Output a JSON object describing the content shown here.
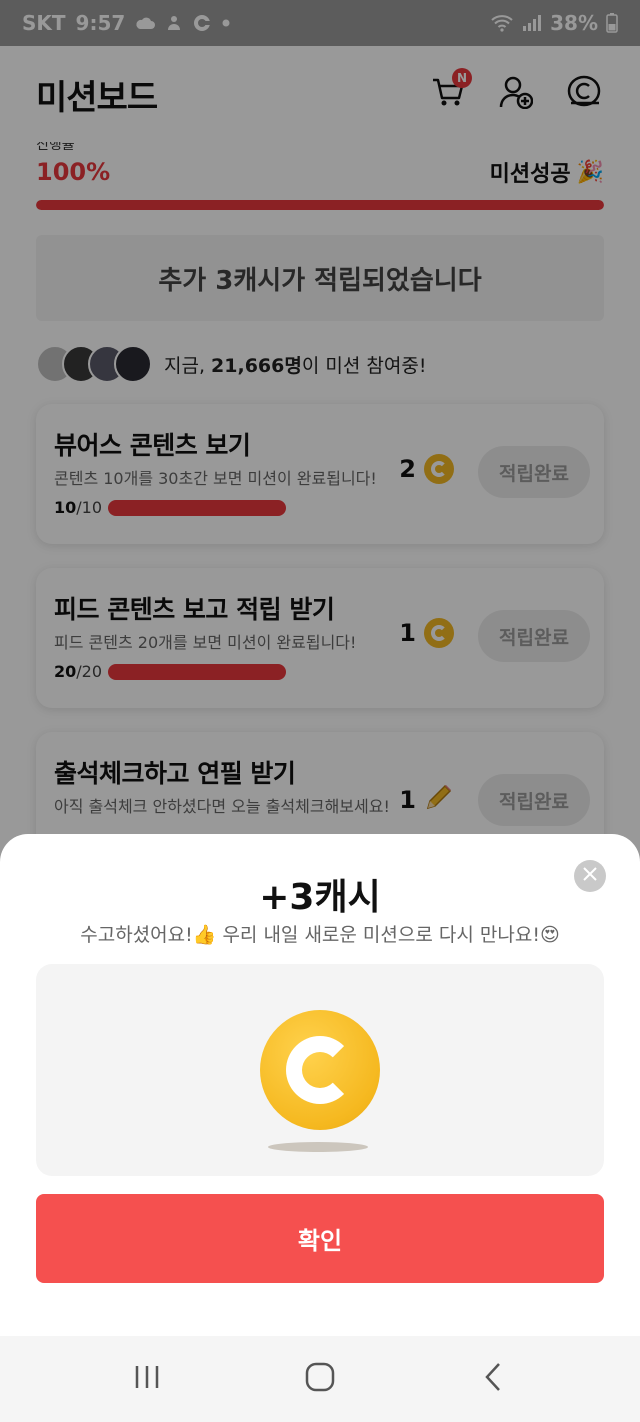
{
  "status_bar": {
    "carrier": "SKT",
    "time": "9:57",
    "battery": "38%"
  },
  "header": {
    "title": "미션보드",
    "cart_badge": "N"
  },
  "progress": {
    "label": "진행률",
    "value_text": "100%",
    "fraction": 1.0,
    "status": "미션성공",
    "status_emoji": "🎉"
  },
  "notice": {
    "text": "추가 3캐시가 적립되었습니다"
  },
  "participants": {
    "prefix": "지금, ",
    "count": "21,666명",
    "suffix": "이 미션 참여중!"
  },
  "missions": [
    {
      "title": "뷰어스 콘텐츠 보기",
      "description": "콘텐츠 10개를 30초간 보면 미션이 완료됩니다!",
      "done": "10",
      "total": "/10",
      "reward": "2",
      "reward_icon": "coin-icon",
      "button": "적립완료"
    },
    {
      "title": "피드 콘텐츠 보고 적립 받기",
      "description": "피드 콘텐츠 20개를 보면 미션이 완료됩니다!",
      "done": "20",
      "total": "/20",
      "reward": "1",
      "reward_icon": "coin-icon",
      "button": "적립완료"
    },
    {
      "title": "출석체크하고 연필 받기",
      "description": "아직 출석체크 안하셨다면 오늘 출석체크해보세요!",
      "reward": "1",
      "reward_icon": "pencil-icon",
      "button": "적립완료"
    }
  ],
  "sheet": {
    "amount": "+3캐시",
    "message_part1": "수고하셨어요!",
    "message_emoji1": "👍",
    "message_part2": " 우리 내일 새로운 미션으로 다시 만나요!",
    "message_emoji2": "😍",
    "confirm_label": "확인"
  },
  "colors": {
    "accent": "#e8373c",
    "confirm": "#f5504f",
    "coin": "#f5b81f"
  }
}
